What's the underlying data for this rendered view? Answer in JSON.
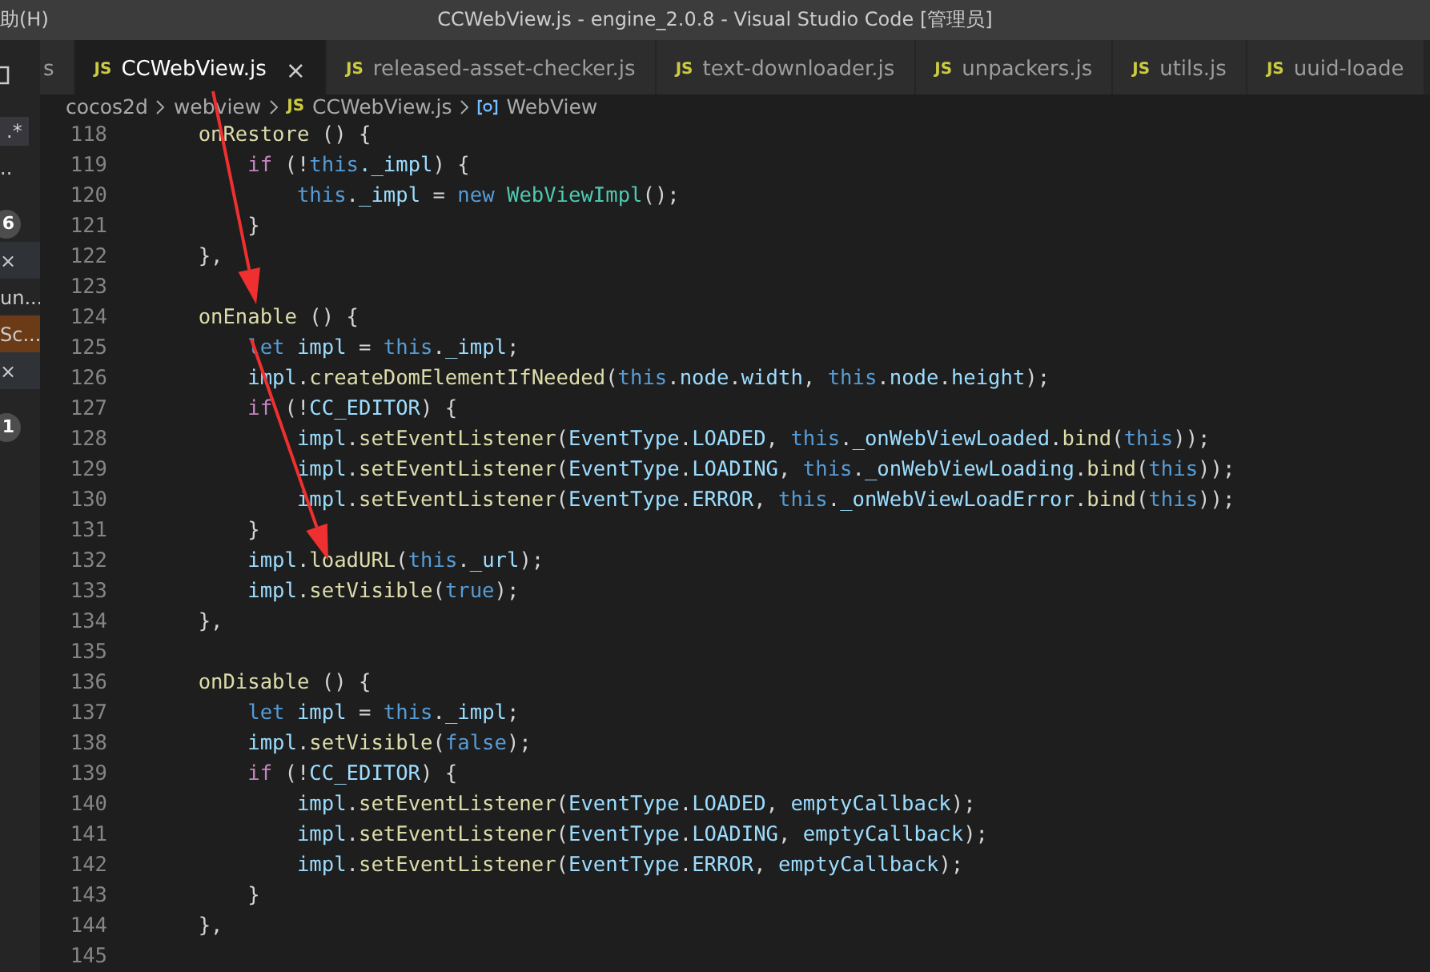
{
  "window": {
    "menu": "助(H)",
    "title": "CCWebView.js - engine_2.0.8 - Visual Studio Code [管理员]"
  },
  "sidebar": {
    "items": [
      {
        "kind": "text",
        "label": ".*",
        "selected": false
      },
      {
        "kind": "text",
        "label": "..",
        "selected": false
      },
      {
        "kind": "badge",
        "label": "6",
        "selected": false
      },
      {
        "kind": "close",
        "label": "×",
        "selected": false
      },
      {
        "kind": "text",
        "label": "un...",
        "selected": false
      },
      {
        "kind": "text",
        "label": "Sc...",
        "selected": true
      },
      {
        "kind": "close",
        "label": "×",
        "selected": false
      },
      {
        "kind": "badge",
        "label": "1",
        "selected": false
      }
    ]
  },
  "tabs": [
    {
      "label": "s",
      "selected": false
    },
    {
      "label": "CCWebView.js",
      "icon": "JS",
      "selected": true,
      "close": "×"
    },
    {
      "label": "released-asset-checker.js",
      "icon": "JS",
      "selected": false
    },
    {
      "label": "text-downloader.js",
      "icon": "JS",
      "selected": false
    },
    {
      "label": "unpackers.js",
      "icon": "JS",
      "selected": false
    },
    {
      "label": "utils.js",
      "icon": "JS",
      "selected": false
    },
    {
      "label": "uuid-loade",
      "icon": "JS",
      "selected": false
    }
  ],
  "breadcrumb": [
    {
      "kind": "folder",
      "label": "cocos2d"
    },
    {
      "kind": "folder",
      "label": "webview"
    },
    {
      "kind": "file",
      "icon": "JS",
      "label": "CCWebView.js"
    },
    {
      "kind": "symbol",
      "label": "WebView"
    }
  ],
  "code": [
    {
      "n": "118",
      "tokens": [
        {
          "kind": "fn",
          "text": "    onRestore"
        },
        {
          "kind": "plain",
          "text": " () {"
        }
      ]
    },
    {
      "n": "119",
      "tokens": [
        {
          "kind": "control",
          "text": "        if"
        },
        {
          "kind": "plain",
          "text": " (!"
        },
        {
          "kind": "keyword",
          "text": "this"
        },
        {
          "kind": "var",
          "text": "._impl"
        },
        {
          "kind": "plain",
          "text": ") {"
        }
      ]
    },
    {
      "n": "120",
      "tokens": [
        {
          "kind": "keyword",
          "text": "            this"
        },
        {
          "kind": "plain",
          "text": "."
        },
        {
          "kind": "var",
          "text": "_impl"
        },
        {
          "kind": "plain",
          "text": " = "
        },
        {
          "kind": "keyword",
          "text": "new"
        },
        {
          "kind": "type",
          "text": " WebViewImpl"
        },
        {
          "kind": "plain",
          "text": "();"
        }
      ]
    },
    {
      "n": "121",
      "tokens": [
        {
          "kind": "plain",
          "text": "        }"
        }
      ]
    },
    {
      "n": "122",
      "tokens": [
        {
          "kind": "plain",
          "text": "    },"
        }
      ]
    },
    {
      "n": "123"
    },
    {
      "n": "124",
      "tokens": [
        {
          "kind": "fn",
          "text": "    onEnable"
        },
        {
          "kind": "plain",
          "text": " () {"
        }
      ]
    },
    {
      "n": "125",
      "tokens": [
        {
          "kind": "keyword",
          "text": "        let"
        },
        {
          "kind": "var",
          "text": " impl"
        },
        {
          "kind": "plain",
          "text": " = "
        },
        {
          "kind": "keyword",
          "text": "this"
        },
        {
          "kind": "plain",
          "text": "."
        },
        {
          "kind": "var",
          "text": "_impl"
        },
        {
          "kind": "plain",
          "text": ";"
        }
      ]
    },
    {
      "n": "126",
      "tokens": [
        {
          "kind": "var",
          "text": "        impl"
        },
        {
          "kind": "plain",
          "text": "."
        },
        {
          "kind": "fn",
          "text": "createDomElementIfNeeded"
        },
        {
          "kind": "plain",
          "text": "("
        },
        {
          "kind": "keyword",
          "text": "this"
        },
        {
          "kind": "plain",
          "text": "."
        },
        {
          "kind": "var",
          "text": "node"
        },
        {
          "kind": "plain",
          "text": "."
        },
        {
          "kind": "var",
          "text": "width"
        },
        {
          "kind": "plain",
          "text": ", "
        },
        {
          "kind": "keyword",
          "text": "this"
        },
        {
          "kind": "plain",
          "text": "."
        },
        {
          "kind": "var",
          "text": "node"
        },
        {
          "kind": "plain",
          "text": "."
        },
        {
          "kind": "var",
          "text": "height"
        },
        {
          "kind": "plain",
          "text": ");"
        }
      ]
    },
    {
      "n": "127",
      "tokens": [
        {
          "kind": "control",
          "text": "        if"
        },
        {
          "kind": "plain",
          "text": " (!"
        },
        {
          "kind": "var",
          "text": "CC_EDITOR"
        },
        {
          "kind": "plain",
          "text": ") {"
        }
      ]
    },
    {
      "n": "128",
      "tokens": [
        {
          "kind": "var",
          "text": "            impl"
        },
        {
          "kind": "plain",
          "text": "."
        },
        {
          "kind": "fn",
          "text": "setEventListener"
        },
        {
          "kind": "plain",
          "text": "("
        },
        {
          "kind": "var",
          "text": "EventType"
        },
        {
          "kind": "plain",
          "text": "."
        },
        {
          "kind": "var",
          "text": "LOADED"
        },
        {
          "kind": "plain",
          "text": ", "
        },
        {
          "kind": "keyword",
          "text": "this"
        },
        {
          "kind": "plain",
          "text": "."
        },
        {
          "kind": "var",
          "text": "_onWebViewLoaded"
        },
        {
          "kind": "plain",
          "text": "."
        },
        {
          "kind": "fn",
          "text": "bind"
        },
        {
          "kind": "plain",
          "text": "("
        },
        {
          "kind": "keyword",
          "text": "this"
        },
        {
          "kind": "plain",
          "text": "));"
        }
      ]
    },
    {
      "n": "129",
      "tokens": [
        {
          "kind": "var",
          "text": "            impl"
        },
        {
          "kind": "plain",
          "text": "."
        },
        {
          "kind": "fn",
          "text": "setEventListener"
        },
        {
          "kind": "plain",
          "text": "("
        },
        {
          "kind": "var",
          "text": "EventType"
        },
        {
          "kind": "plain",
          "text": "."
        },
        {
          "kind": "var",
          "text": "LOADING"
        },
        {
          "kind": "plain",
          "text": ", "
        },
        {
          "kind": "keyword",
          "text": "this"
        },
        {
          "kind": "plain",
          "text": "."
        },
        {
          "kind": "var",
          "text": "_onWebViewLoading"
        },
        {
          "kind": "plain",
          "text": "."
        },
        {
          "kind": "fn",
          "text": "bind"
        },
        {
          "kind": "plain",
          "text": "("
        },
        {
          "kind": "keyword",
          "text": "this"
        },
        {
          "kind": "plain",
          "text": "));"
        }
      ]
    },
    {
      "n": "130",
      "tokens": [
        {
          "kind": "var",
          "text": "            impl"
        },
        {
          "kind": "plain",
          "text": "."
        },
        {
          "kind": "fn",
          "text": "setEventListener"
        },
        {
          "kind": "plain",
          "text": "("
        },
        {
          "kind": "var",
          "text": "EventType"
        },
        {
          "kind": "plain",
          "text": "."
        },
        {
          "kind": "var",
          "text": "ERROR"
        },
        {
          "kind": "plain",
          "text": ", "
        },
        {
          "kind": "keyword",
          "text": "this"
        },
        {
          "kind": "plain",
          "text": "."
        },
        {
          "kind": "var",
          "text": "_onWebViewLoadError"
        },
        {
          "kind": "plain",
          "text": "."
        },
        {
          "kind": "fn",
          "text": "bind"
        },
        {
          "kind": "plain",
          "text": "("
        },
        {
          "kind": "keyword",
          "text": "this"
        },
        {
          "kind": "plain",
          "text": "));"
        }
      ]
    },
    {
      "n": "131",
      "tokens": [
        {
          "kind": "plain",
          "text": "        }"
        }
      ]
    },
    {
      "n": "132",
      "tokens": [
        {
          "kind": "var",
          "text": "        impl"
        },
        {
          "kind": "plain",
          "text": "."
        },
        {
          "kind": "fn",
          "text": "loadURL"
        },
        {
          "kind": "plain",
          "text": "("
        },
        {
          "kind": "keyword",
          "text": "this"
        },
        {
          "kind": "plain",
          "text": "."
        },
        {
          "kind": "var",
          "text": "_url"
        },
        {
          "kind": "plain",
          "text": ");"
        }
      ]
    },
    {
      "n": "133",
      "tokens": [
        {
          "kind": "var",
          "text": "        impl"
        },
        {
          "kind": "plain",
          "text": "."
        },
        {
          "kind": "fn",
          "text": "setVisible"
        },
        {
          "kind": "plain",
          "text": "("
        },
        {
          "kind": "keyword",
          "text": "true"
        },
        {
          "kind": "plain",
          "text": ");"
        }
      ]
    },
    {
      "n": "134",
      "tokens": [
        {
          "kind": "plain",
          "text": "    },"
        }
      ]
    },
    {
      "n": "135"
    },
    {
      "n": "136",
      "tokens": [
        {
          "kind": "fn",
          "text": "    onDisable"
        },
        {
          "kind": "plain",
          "text": " () {"
        }
      ]
    },
    {
      "n": "137",
      "tokens": [
        {
          "kind": "keyword",
          "text": "        let"
        },
        {
          "kind": "var",
          "text": " impl"
        },
        {
          "kind": "plain",
          "text": " = "
        },
        {
          "kind": "keyword",
          "text": "this"
        },
        {
          "kind": "plain",
          "text": "."
        },
        {
          "kind": "var",
          "text": "_impl"
        },
        {
          "kind": "plain",
          "text": ";"
        }
      ]
    },
    {
      "n": "138",
      "tokens": [
        {
          "kind": "var",
          "text": "        impl"
        },
        {
          "kind": "plain",
          "text": "."
        },
        {
          "kind": "fn",
          "text": "setVisible"
        },
        {
          "kind": "plain",
          "text": "("
        },
        {
          "kind": "keyword",
          "text": "false"
        },
        {
          "kind": "plain",
          "text": ");"
        }
      ]
    },
    {
      "n": "139",
      "tokens": [
        {
          "kind": "control",
          "text": "        if"
        },
        {
          "kind": "plain",
          "text": " (!"
        },
        {
          "kind": "var",
          "text": "CC_EDITOR"
        },
        {
          "kind": "plain",
          "text": ") {"
        }
      ]
    },
    {
      "n": "140",
      "tokens": [
        {
          "kind": "var",
          "text": "            impl"
        },
        {
          "kind": "plain",
          "text": "."
        },
        {
          "kind": "fn",
          "text": "setEventListener"
        },
        {
          "kind": "plain",
          "text": "("
        },
        {
          "kind": "var",
          "text": "EventType"
        },
        {
          "kind": "plain",
          "text": "."
        },
        {
          "kind": "var",
          "text": "LOADED"
        },
        {
          "kind": "plain",
          "text": ", "
        },
        {
          "kind": "var",
          "text": "emptyCallback"
        },
        {
          "kind": "plain",
          "text": ");"
        }
      ]
    },
    {
      "n": "141",
      "tokens": [
        {
          "kind": "var",
          "text": "            impl"
        },
        {
          "kind": "plain",
          "text": "."
        },
        {
          "kind": "fn",
          "text": "setEventListener"
        },
        {
          "kind": "plain",
          "text": "("
        },
        {
          "kind": "var",
          "text": "EventType"
        },
        {
          "kind": "plain",
          "text": "."
        },
        {
          "kind": "var",
          "text": "LOADING"
        },
        {
          "kind": "plain",
          "text": ", "
        },
        {
          "kind": "var",
          "text": "emptyCallback"
        },
        {
          "kind": "plain",
          "text": ");"
        }
      ]
    },
    {
      "n": "142",
      "tokens": [
        {
          "kind": "var",
          "text": "            impl"
        },
        {
          "kind": "plain",
          "text": "."
        },
        {
          "kind": "fn",
          "text": "setEventListener"
        },
        {
          "kind": "plain",
          "text": "("
        },
        {
          "kind": "var",
          "text": "EventType"
        },
        {
          "kind": "plain",
          "text": "."
        },
        {
          "kind": "var",
          "text": "ERROR"
        },
        {
          "kind": "plain",
          "text": ", "
        },
        {
          "kind": "var",
          "text": "emptyCallback"
        },
        {
          "kind": "plain",
          "text": ");"
        }
      ]
    },
    {
      "n": "143",
      "tokens": [
        {
          "kind": "plain",
          "text": "        }"
        }
      ]
    },
    {
      "n": "144",
      "tokens": [
        {
          "kind": "plain",
          "text": "    },"
        }
      ]
    },
    {
      "n": "145"
    }
  ],
  "annotations": [
    {
      "kind": "arrow"
    },
    {
      "kind": "arrow"
    }
  ]
}
